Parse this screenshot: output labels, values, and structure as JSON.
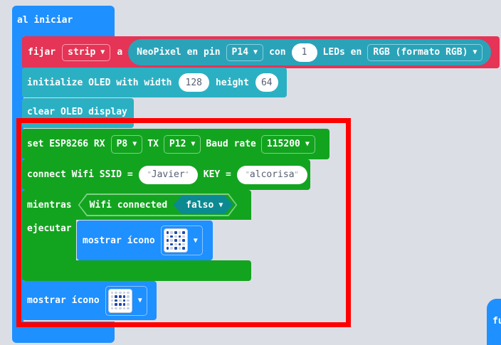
{
  "canvas": {
    "background": "#eef1f5",
    "grid_color": "#d9dde4"
  },
  "colors": {
    "event_blue": "#1e90ff",
    "neopixel_red": "#e53455",
    "neopixel_teal": "#2aa3b9",
    "oled_teal": "#2bb0c3",
    "esp_green": "#13a41f",
    "basic_blue": "#1e90ff",
    "highlight_red": "#ff0000"
  },
  "on_start": {
    "label": "al iniciar"
  },
  "neopixel": {
    "set_label": "fijar",
    "var_dropdown": "strip",
    "a_label": "a",
    "neopixel_label": "NeoPixel en pin",
    "pin_dropdown": "P14",
    "con_label": "con",
    "count_value": "1",
    "leds_label": "LEDs en",
    "mode_dropdown": "RGB (formato RGB)"
  },
  "oled_init": {
    "label": "initialize OLED with width",
    "width_value": "128",
    "height_label": "height",
    "height_value": "64"
  },
  "oled_clear": {
    "label": "clear OLED display"
  },
  "esp_set": {
    "label": "set ESP8266 RX",
    "rx_dropdown": "P8",
    "tx_label": "TX",
    "tx_dropdown": "P12",
    "baud_label": "Baud rate",
    "baud_dropdown": "115200"
  },
  "wifi_connect": {
    "label": "connect Wifi SSID =",
    "ssid_value": "Javier",
    "key_label": "KEY =",
    "key_value": "alcorisa"
  },
  "while_loop": {
    "while_label": "mientras",
    "condition_label": "Wifi connected",
    "condition_dropdown": "falso",
    "do_label": "ejecutar"
  },
  "show_icon_inner": {
    "label": "mostrar ícono",
    "icon_leds": [
      1,
      0,
      1,
      0,
      1,
      0,
      1,
      0,
      1,
      0,
      1,
      0,
      1,
      0,
      1,
      0,
      1,
      0,
      1,
      0,
      1,
      0,
      1,
      0,
      1
    ]
  },
  "show_icon_outer": {
    "label": "mostrar ícono",
    "icon_leds": [
      0,
      0,
      0,
      0,
      0,
      0,
      1,
      1,
      1,
      0,
      0,
      1,
      0,
      1,
      0,
      0,
      1,
      1,
      1,
      0,
      0,
      0,
      0,
      0,
      0
    ]
  },
  "partial_block": {
    "label": "fu"
  },
  "quote_char": "\""
}
